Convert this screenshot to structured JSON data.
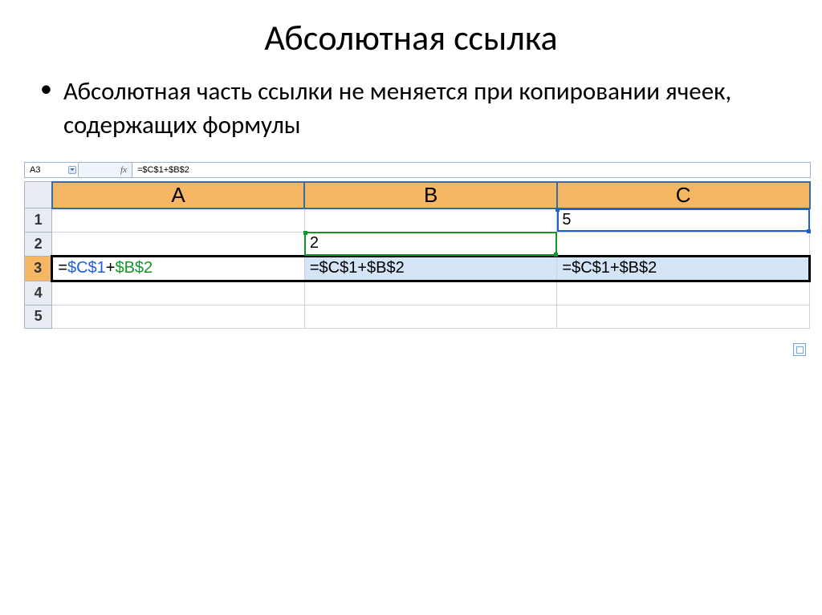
{
  "title": "Абсолютная ссылка",
  "bullet": "Абсолютная часть ссылки не меняется при копировании ячеек, содержащих формулы",
  "formula_bar": {
    "name_box": "A3",
    "fx_label": "fx",
    "formula": "=$C$1+$B$2"
  },
  "columns": [
    "A",
    "B",
    "C"
  ],
  "rows": [
    "1",
    "2",
    "3",
    "4",
    "5"
  ],
  "cells": {
    "C1": "5",
    "B2": "2",
    "A3_tok0": "=",
    "A3_tok1": "$C$1",
    "A3_tok2": "+",
    "A3_tok3": "$B$2",
    "B3": "=$C$1+$B$2",
    "C3": "=$C$1+$B$2"
  }
}
